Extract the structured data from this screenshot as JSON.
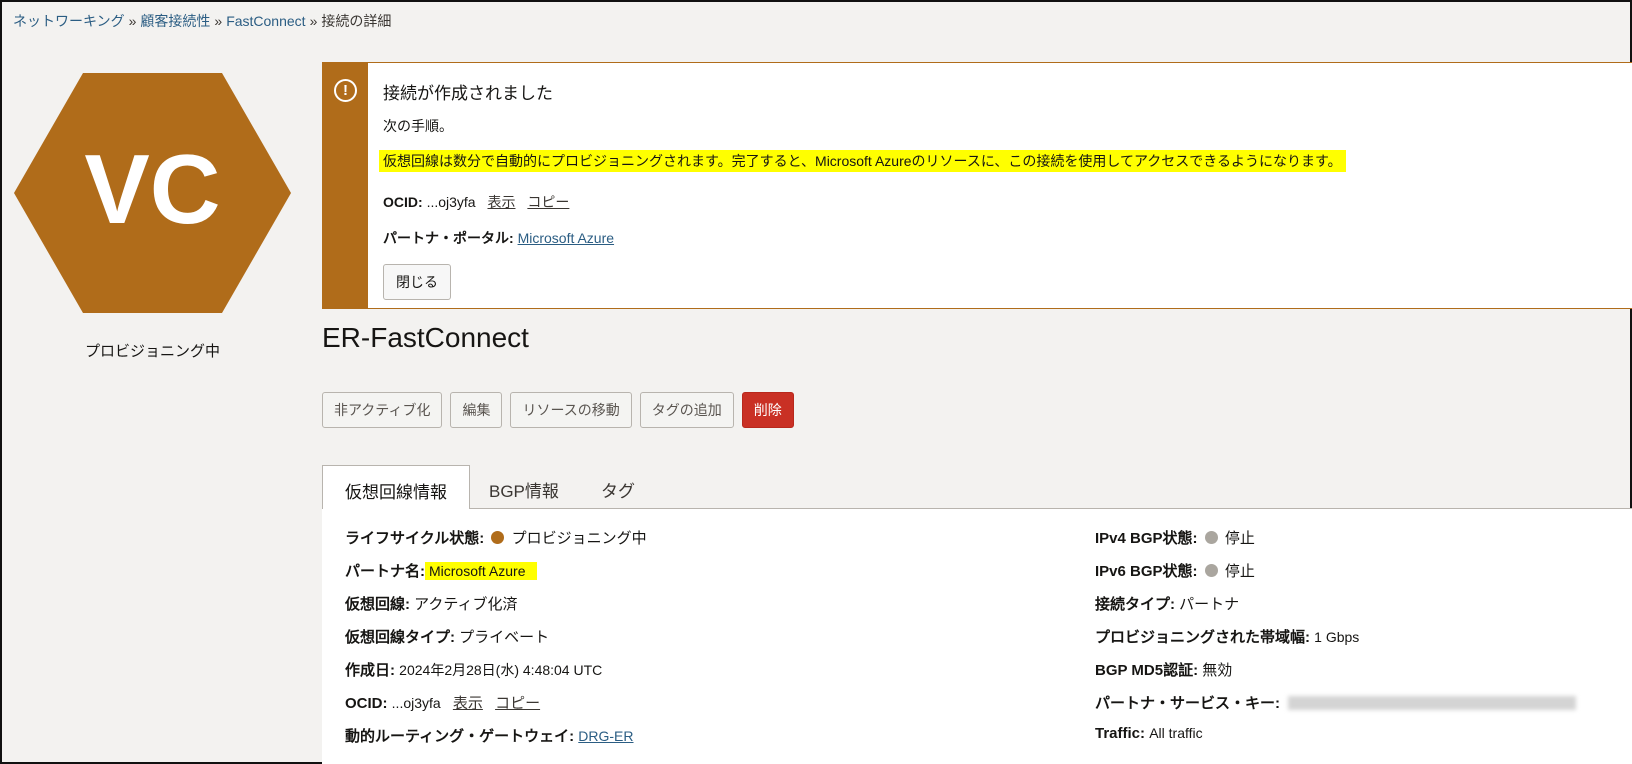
{
  "breadcrumb": {
    "items": [
      "ネットワーキング",
      "顧客接続性",
      "FastConnect"
    ],
    "current": "接続の詳細",
    "sep": "»"
  },
  "hex": {
    "initials": "VC",
    "caption": "プロビジョニング中",
    "color": "#b06c1a"
  },
  "notice": {
    "icon": "!",
    "title": "接続が作成されました",
    "subtitle": "次の手順。",
    "message": "仮想回線は数分で自動的にプロビジョニングされます。完了すると、Microsoft Azureのリソースに、この接続を使用してアクセスできるようになります。",
    "ocid_label": "OCID:",
    "ocid_value": "...oj3yfa",
    "show_link": "表示",
    "copy_link": "コピー",
    "portal_label": "パートナ・ポータル:",
    "portal_link": "Microsoft Azure",
    "close_button": "閉じる"
  },
  "title": "ER-FastConnect",
  "actions": {
    "deactivate": "非アクティブ化",
    "edit": "編集",
    "move": "リソースの移動",
    "add_tags": "タグの追加",
    "delete": "削除"
  },
  "tabs": [
    "仮想回線情報",
    "BGP情報",
    "タグ"
  ],
  "details_left": {
    "lifecycle_label": "ライフサイクル状態:",
    "lifecycle_value": "プロビジョニング中",
    "partner_label": "パートナ名:",
    "partner_value": "Microsoft Azure",
    "vc_label": "仮想回線:",
    "vc_value": "アクティブ化済",
    "vc_type_label": "仮想回線タイプ:",
    "vc_type_value": "プライベート",
    "created_label": "作成日:",
    "created_value": "2024年2月28日(水) 4:48:04 UTC",
    "ocid_label": "OCID:",
    "ocid_value": "...oj3yfa",
    "show_link": "表示",
    "copy_link": "コピー",
    "drg_label": "動的ルーティング・ゲートウェイ:",
    "drg_value": "DRG-ER"
  },
  "details_right": {
    "ipv4_label": "IPv4 BGP状態:",
    "ipv4_value": "停止",
    "ipv6_label": "IPv6 BGP状態:",
    "ipv6_value": "停止",
    "conn_type_label": "接続タイプ:",
    "conn_type_value": "パートナ",
    "bandwidth_label": "プロビジョニングされた帯域幅:",
    "bandwidth_value": "1 Gbps",
    "md5_label": "BGP MD5認証:",
    "md5_value": "無効",
    "service_key_label": "パートナ・サービス・キー:",
    "traffic_label": "Traffic:",
    "traffic_value": "All traffic"
  },
  "colors": {
    "accent": "#b06c1a",
    "danger": "#c93024",
    "highlight": "#ffff00",
    "stopped_dot": "#aaa69f"
  }
}
